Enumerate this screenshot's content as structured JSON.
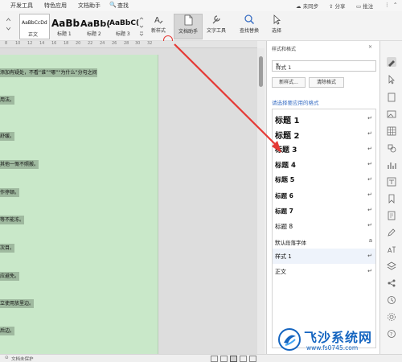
{
  "menu": {
    "items": [
      "开发工具",
      "特色应用",
      "文档助手"
    ],
    "search": "查找",
    "status_unsync": "未同步",
    "share": "分享",
    "comment": "批注"
  },
  "ribbon": {
    "style_gallery": [
      {
        "preview": "AaBbCcDd",
        "label": "正文"
      },
      {
        "preview": "AaBb",
        "label": "标题 1"
      },
      {
        "preview": "AaBb(",
        "label": "标题 2"
      },
      {
        "preview": "AaBbC(",
        "label": "标题 3"
      }
    ],
    "new_style": "新样式",
    "doc_assistant": "文档助手",
    "text_tools": "文字工具",
    "find_replace": "查找替换",
    "select": "选择"
  },
  "ruler": {
    "numbers": [
      "8",
      "10",
      "12",
      "14",
      "16",
      "18",
      "20",
      "22",
      "24",
      "26",
      "28",
      "30",
      "32"
    ]
  },
  "document": {
    "lines": [
      "添加有疑处，不看“谁”“哪”“为什么”分句之间",
      "用法。",
      "舒缓。",
      "其他一慨不照搬。",
      "作停顿。",
      "等不能冻。",
      "次目。",
      "应避免。",
      "立使用放里边。",
      "后边。"
    ]
  },
  "panel": {
    "title": "样式和格式",
    "current_style": "样式 1",
    "new_button": "新样式...",
    "clear_button": "清除格式",
    "section_label": "请选择要应用的格式",
    "styles": [
      {
        "name": "标题 1",
        "marker": "↵"
      },
      {
        "name": "标题 2",
        "marker": "↵"
      },
      {
        "name": "标题 3",
        "marker": "↵"
      },
      {
        "name": "标题 4",
        "marker": "↵"
      },
      {
        "name": "标题 5",
        "marker": "↵"
      },
      {
        "name": "标题 6",
        "marker": "↵"
      },
      {
        "name": "标题 7",
        "marker": "↵"
      },
      {
        "name": "标题 8",
        "marker": "↵"
      },
      {
        "name": "默认段落字体",
        "marker": "a"
      },
      {
        "name": "样式 1",
        "marker": "↵"
      },
      {
        "name": "正文",
        "marker": "↵"
      }
    ]
  },
  "statusbar": {
    "text": "文档未保护"
  },
  "watermark": {
    "name": "飞沙系统网",
    "url": "www.fs0745.com"
  },
  "colors": {
    "accent": "#3a6fc4",
    "annotation": "#e53935",
    "page": "#c9e8c9",
    "watermark": "#1565c0"
  }
}
